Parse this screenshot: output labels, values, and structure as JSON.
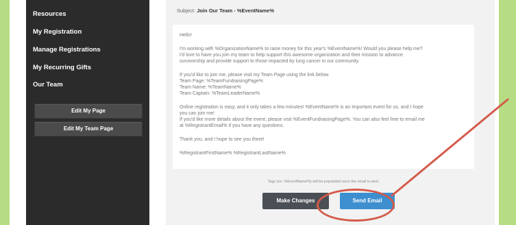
{
  "sidebar": {
    "items": [
      {
        "label": "Resources"
      },
      {
        "label": "My Registration"
      },
      {
        "label": "Manage Registrations"
      },
      {
        "label": "My Recurring Gifts"
      },
      {
        "label": "Our Team"
      }
    ],
    "buttons": [
      {
        "label": "Edit My Page"
      },
      {
        "label": "Edit My Team Page"
      }
    ]
  },
  "email": {
    "subject_label": "Subject:",
    "subject_value": "Join Our Team - %EventName%",
    "lines": [
      "Hello!",
      "I'm working with %OrganizationName% to raise money for this year's %EventName%! Would you please help me?",
      "I'd love to have you join my team to help support this awesome organization and their mission to advance",
      "survivorship and provide support to those impacted by lung cancer in our community.",
      "If you'd like to join me, please visit my Team Page using the link below.",
      "Team Page: %TeamFundraisingPage%",
      "Team Name: %TeamName%",
      "Team Captain: %TeamLeaderName%",
      "Online registration is easy, and it only takes a few minutes! %EventName% is an important event for us, and I hope",
      "you can join me!",
      "If you'd like more details about the event, please visit %EventFundraisingPage%. You can also feel free to email me",
      "at %RegistrantEmail% if you have any questions.",
      "Thank you, and I hope to see you there!",
      "%RegistrantFirstName% %RegistrantLastName%"
    ]
  },
  "tags_note": "Tags (ex. %EventName%) will be populated once the email is sent.",
  "actions": {
    "make_changes": "Make Changes",
    "send_email": "Send Email"
  },
  "colors": {
    "background_green": "#b7dd84",
    "sidebar": "#2b2b2b",
    "send_button": "#3d8fd0",
    "make_changes_button": "#4a4f55",
    "annotation_red": "#d45a4a"
  }
}
